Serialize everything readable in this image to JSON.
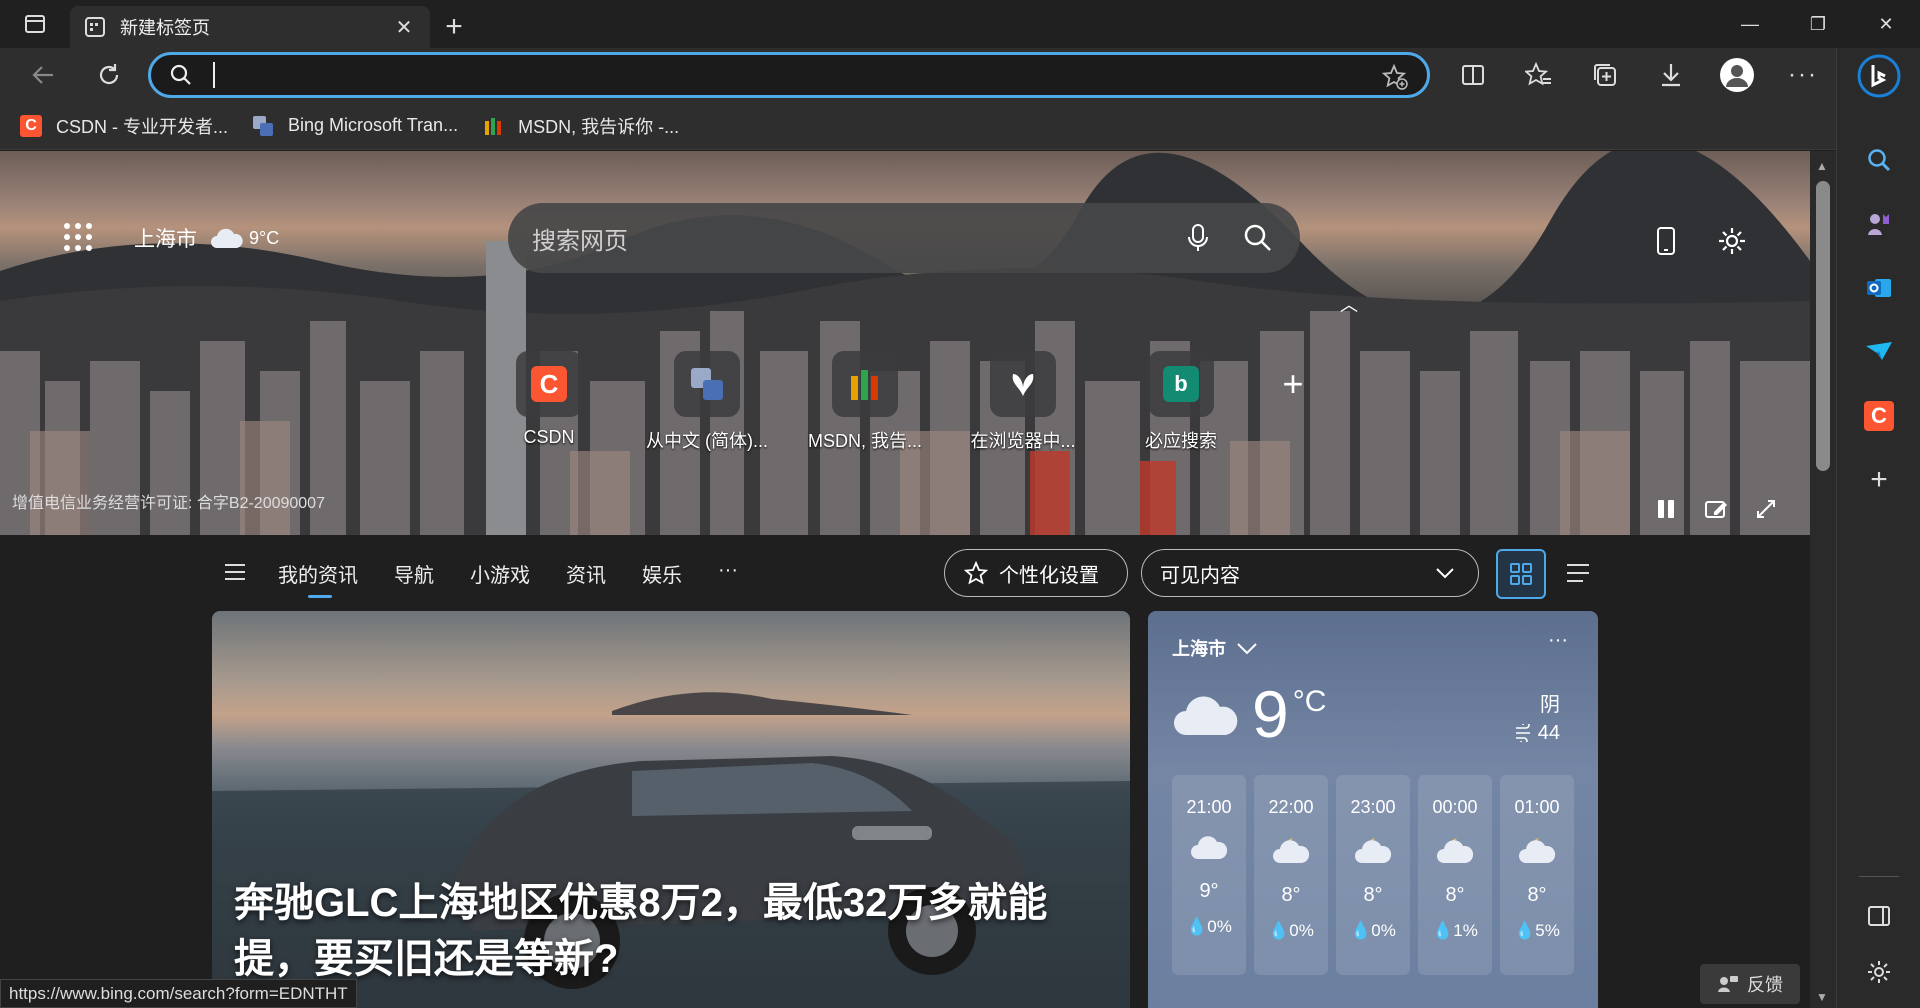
{
  "tab": {
    "title": "新建标签页"
  },
  "bookmarks": [
    {
      "label": "CSDN - 专业开发者...",
      "color": "#fc5531"
    },
    {
      "label": "Bing Microsoft Tran...",
      "color": "#4a6fb5"
    },
    {
      "label": "MSDN, 我告诉你 -...",
      "color": "#e8a200"
    }
  ],
  "hero": {
    "location": "上海市",
    "temp": "9°C",
    "search_placeholder": "搜索网页",
    "license": "增值电信业务经营许可证: 合字B2-20090007"
  },
  "quicklinks": [
    {
      "label": "CSDN",
      "letter": "C",
      "color": "#fc5531"
    },
    {
      "label": "从中文 (简体)...",
      "letter": "",
      "color": "#4a6fb5"
    },
    {
      "label": "MSDN, 我告...",
      "letter": "",
      "color": "#e8a200"
    },
    {
      "label": "在浏览器中...",
      "letter": "",
      "color": "#333333"
    },
    {
      "label": "必应搜索",
      "letter": "b",
      "color": "#138a72"
    }
  ],
  "feed": {
    "tabs": [
      "我的资讯",
      "导航",
      "小游戏",
      "资讯",
      "娱乐",
      "···"
    ],
    "personalize_label": "个性化设置",
    "visible_label": "可见内容"
  },
  "news": {
    "title": "奔驰GLC上海地区优惠8万2，最低32万多就能提，要买旧还是等新?"
  },
  "weather": {
    "city": "上海市",
    "temp": "9",
    "unit": "°C",
    "condition": "阴",
    "aqi": "44",
    "hourly": [
      {
        "time": "21:00",
        "icon": "cloud-icon",
        "temp": "9°",
        "rain": "0%"
      },
      {
        "time": "22:00",
        "icon": "partly-cloudy-night-icon",
        "temp": "8°",
        "rain": "0%"
      },
      {
        "time": "23:00",
        "icon": "partly-cloudy-night-icon",
        "temp": "8°",
        "rain": "0%"
      },
      {
        "time": "00:00",
        "icon": "partly-cloudy-night-icon",
        "temp": "8°",
        "rain": "1%"
      },
      {
        "time": "01:00",
        "icon": "partly-cloudy-night-icon",
        "temp": "8°",
        "rain": "5%"
      }
    ]
  },
  "status": {
    "url": "https://www.bing.com/search?form=EDNTHT"
  },
  "feedback_label": "反馈",
  "colors": {
    "accent": "#4fa8e8",
    "bing": "#1a7fd6"
  }
}
